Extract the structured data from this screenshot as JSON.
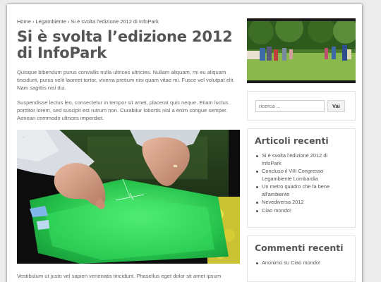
{
  "breadcrumb": {
    "home": "Home",
    "category": "Legambiente",
    "current": "Si è svolta l'edizione 2012 di InfoPark",
    "separator": "›"
  },
  "post": {
    "title": "Si è svolta l’edizione 2012 di InfoPark",
    "paragraphs": [
      "Quisque bibendum purus convallis nulla ultrices ultricies. Nullam aliquam, mi eu aliquam tincidunt, purus velit laoreet tortor, viverra pretium nisi quam vitae mi. Fusce vel volutpat elit. Nam sagittis nisi dui.",
      "Suspendisse lectus leo, consectetur in tempor sit amet, placerat quis neque. Etiam luctus porttitor lorem, sed suscipit est rutrum non. Curabitur lobortis nisl a enim congue semper. Aenean commodo ultrices imperdiet."
    ],
    "trailing_text": "Vestibulum ut justo vel sapien venenatis tincidunt. Phasellus eget dolor sit amet ipsum"
  },
  "search": {
    "placeholder": "ricerca ...",
    "button_label": "Vai"
  },
  "recent_posts": {
    "heading": "Articoli recenti",
    "items": [
      "Si è svolta l'edizione 2012 di InfoPark",
      "Concluso il VIII Congresso Legambiente Lombardia",
      "Un metro quadro che fa bene all'ambiente",
      "Nevediversa 2012",
      "Ciao mondo!"
    ]
  },
  "recent_comments": {
    "heading": "Commenti recenti",
    "items": [
      "Anonimo su Ciao mondo!"
    ]
  },
  "colors": {
    "kite_green": "#2fd45a",
    "text": "#555555",
    "page_bg": "#ececec"
  }
}
